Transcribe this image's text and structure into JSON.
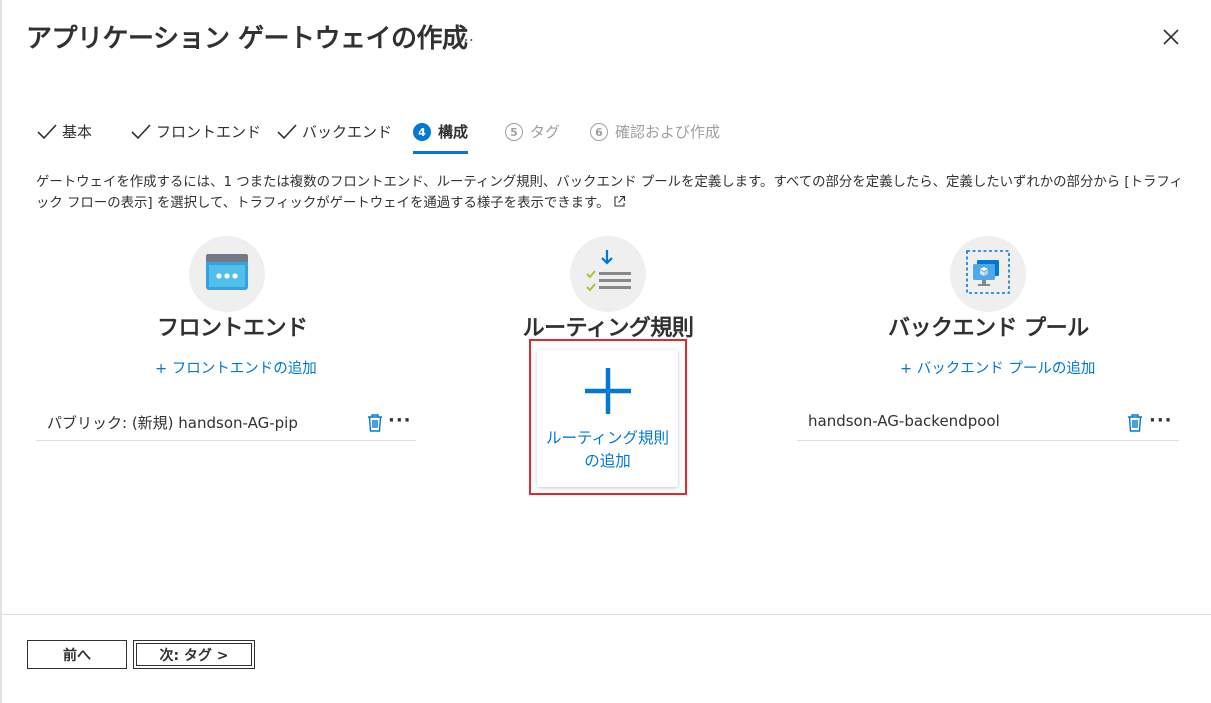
{
  "page": {
    "title": "アプリケーション ゲートウェイの作成",
    "title_more": "…"
  },
  "steps": [
    {
      "label": "基本",
      "state": "done"
    },
    {
      "label": "フロントエンド",
      "state": "done"
    },
    {
      "label": "バックエンド",
      "state": "done"
    },
    {
      "number": "4",
      "label": "構成",
      "state": "active"
    },
    {
      "number": "5",
      "label": "タグ",
      "state": "future"
    },
    {
      "number": "6",
      "label": "確認および作成",
      "state": "future"
    }
  ],
  "description": "ゲートウェイを作成するには、1 つまたは複数のフロントエンド、ルーティング規則、バックエンド プールを定義します。すべての部分を定義したら、定義したいずれかの部分から [トラフィック フローの表示] を選択して、トラフィックがゲートウェイを通過する様子を表示できます。",
  "frontend": {
    "title": "フロントエンド",
    "add_link": "+ フロントエンドの追加",
    "items": [
      {
        "text": "パブリック: (新規) handson-AG-pip"
      }
    ]
  },
  "routing": {
    "title": "ルーティング規則",
    "add_card_line1": "ルーティング規則",
    "add_card_line2": "の追加"
  },
  "backend": {
    "title": "バックエンド プール",
    "add_link": "+ バックエンド プールの追加",
    "items": [
      {
        "text": "handson-AG-backendpool"
      }
    ]
  },
  "row_more": "···",
  "footer": {
    "prev_label": "前へ",
    "next_label": "次: タグ >"
  },
  "colors": {
    "accent": "#0078d4",
    "highlight": "#e0282e",
    "text": "#323130",
    "disabled": "#a19f9d"
  }
}
